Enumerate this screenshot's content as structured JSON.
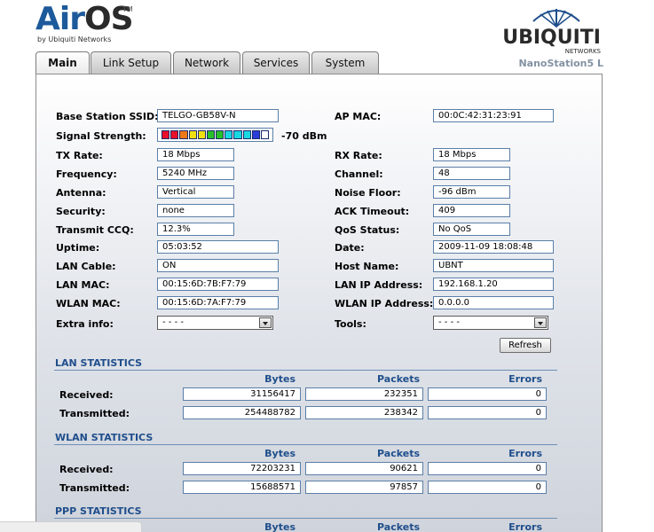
{
  "header": {
    "logo_air": "Air",
    "logo_os": "OS",
    "logo_tm": "TM",
    "logo_sub": "by Ubiquiti Networks",
    "brand": "UBIQUITI",
    "brand_sub": "NETWORKS",
    "device_name": "NanoStation5 L"
  },
  "tabs": [
    {
      "label": "Main",
      "active": true
    },
    {
      "label": "Link Setup",
      "active": false
    },
    {
      "label": "Network",
      "active": false
    },
    {
      "label": "Services",
      "active": false
    },
    {
      "label": "System",
      "active": false
    }
  ],
  "status": {
    "base_ssid_label": "Base Station SSID:",
    "base_ssid": "TELGO-GB58V-N",
    "ap_mac_label": "AP MAC:",
    "ap_mac": "00:0C:42:31:23:91",
    "signal_label": "Signal Strength:",
    "signal_value": "-70 dBm",
    "signal_bars": [
      "#e8102a",
      "#e8102a",
      "#f07818",
      "#f0e010",
      "#f0e010",
      "#28c028",
      "#28c028",
      "#18d8e0",
      "#18d8e0",
      "#18d8e0",
      "#2a3cd8",
      "#ffffff"
    ],
    "tx_rate_label": "TX Rate:",
    "tx_rate": "18 Mbps",
    "rx_rate_label": "RX Rate:",
    "rx_rate": "18 Mbps",
    "frequency_label": "Frequency:",
    "frequency": "5240 MHz",
    "channel_label": "Channel:",
    "channel": "48",
    "antenna_label": "Antenna:",
    "antenna": "Vertical",
    "noise_floor_label": "Noise Floor:",
    "noise_floor": "-96 dBm",
    "security_label": "Security:",
    "security": "none",
    "ack_timeout_label": "ACK Timeout:",
    "ack_timeout": "409",
    "ccq_label": "Transmit CCQ:",
    "ccq": "12.3%",
    "qos_label": "QoS Status:",
    "qos": "No QoS",
    "uptime_label": "Uptime:",
    "uptime": "05:03:52",
    "date_label": "Date:",
    "date": "2009-11-09 18:08:48",
    "lan_cable_label": "LAN Cable:",
    "lan_cable": "ON",
    "host_name_label": "Host Name:",
    "host_name": "UBNT",
    "lan_mac_label": "LAN MAC:",
    "lan_mac": "00:15:6D:7B:F7:79",
    "lan_ip_label": "LAN IP Address:",
    "lan_ip": "192.168.1.20",
    "wlan_mac_label": "WLAN MAC:",
    "wlan_mac": "00:15:6D:7A:F7:79",
    "wlan_ip_label": "WLAN IP Address:",
    "wlan_ip": "0.0.0.0",
    "extra_info_label": "Extra info:",
    "extra_info": "- - - -",
    "tools_label": "Tools:",
    "tools": "- - - -",
    "refresh_label": "Refresh"
  },
  "stats_columns": {
    "bytes": "Bytes",
    "packets": "Packets",
    "errors": "Errors"
  },
  "lan_stats": {
    "title": "LAN STATISTICS",
    "received_label": "Received:",
    "received": {
      "bytes": "31156417",
      "packets": "232351",
      "errors": "0"
    },
    "transmitted_label": "Transmitted:",
    "transmitted": {
      "bytes": "254488782",
      "packets": "238342",
      "errors": "0"
    }
  },
  "wlan_stats": {
    "title": "WLAN STATISTICS",
    "received_label": "Received:",
    "received": {
      "bytes": "72203231",
      "packets": "90621",
      "errors": "0"
    },
    "transmitted_label": "Transmitted:",
    "transmitted": {
      "bytes": "15688571",
      "packets": "97857",
      "errors": "0"
    }
  },
  "ppp_stats": {
    "title": "PPP STATISTICS"
  }
}
